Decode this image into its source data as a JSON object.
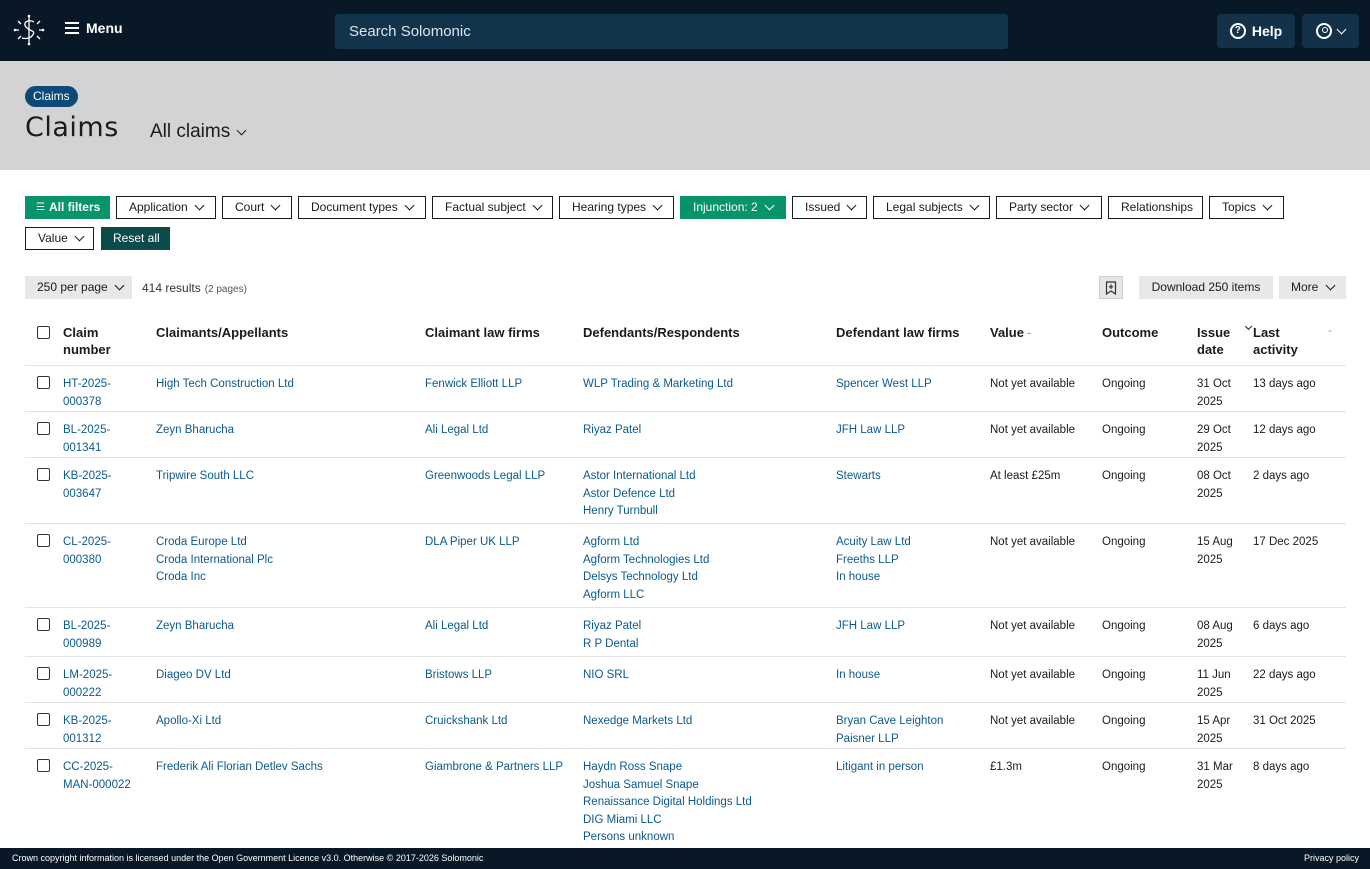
{
  "nav": {
    "menu_label": "Menu",
    "search_placeholder": "Search Solomonic",
    "help_label": "Help"
  },
  "header": {
    "breadcrumb": "Claims",
    "title": "Claims",
    "view": "All claims"
  },
  "filters": {
    "all_filters": "All filters",
    "items": [
      "Application",
      "Court",
      "Document types",
      "Factual subject",
      "Hearing types",
      "Injunction: 2",
      "Issued",
      "Legal subjects",
      "Party sector",
      "Relationships",
      "Topics",
      "Value"
    ],
    "reset": "Reset all"
  },
  "results": {
    "per_page": "250 per page",
    "count": "414 results",
    "pages": "(2 pages)",
    "download": "Download 250 items",
    "more": "More"
  },
  "table": {
    "columns": [
      "Claim number",
      "Claimants/Appellants",
      "Claimant law firms",
      "Defendants/Respondents",
      "Defendant law firms",
      "Value",
      "Outcome",
      "Issue date",
      "Last activity"
    ],
    "rows": [
      {
        "claim": [
          "HT-2025-",
          "000378"
        ],
        "claimants": [
          "High Tech Construction Ltd"
        ],
        "claimant_firms": [
          "Fenwick Elliott LLP"
        ],
        "defendants": [
          "WLP Trading & Marketing Ltd"
        ],
        "defendant_firms": [
          "Spencer West LLP"
        ],
        "value": "Not yet available",
        "outcome": "Ongoing",
        "issue_date": [
          "31 Oct",
          "2025"
        ],
        "last_activity": "13 days ago"
      },
      {
        "claim": [
          "BL-2025-",
          "001341"
        ],
        "claimants": [
          "Zeyn Bharucha"
        ],
        "claimant_firms": [
          "Ali Legal Ltd"
        ],
        "defendants": [
          "Riyaz Patel"
        ],
        "defendant_firms": [
          "JFH Law LLP"
        ],
        "value": "Not yet available",
        "outcome": "Ongoing",
        "issue_date": [
          "29 Oct",
          "2025"
        ],
        "last_activity": "12 days ago"
      },
      {
        "claim": [
          "KB-2025-",
          "003647"
        ],
        "claimants": [
          "Tripwire South LLC"
        ],
        "claimant_firms": [
          "Greenwoods Legal LLP"
        ],
        "defendants": [
          "Astor International Ltd",
          "Astor Defence Ltd",
          "Henry Turnbull"
        ],
        "defendant_firms": [
          "Stewarts"
        ],
        "value": "At least £25m",
        "outcome": "Ongoing",
        "issue_date": [
          "08 Oct",
          "2025"
        ],
        "last_activity": "2 days ago"
      },
      {
        "claim": [
          "CL-2025-",
          "000380"
        ],
        "claimants": [
          "Croda Europe Ltd",
          "Croda International Plc",
          "Croda Inc"
        ],
        "claimant_firms": [
          "DLA Piper UK LLP"
        ],
        "defendants": [
          "Agform Ltd",
          "Agform Technologies Ltd",
          "Delsys Technology Ltd",
          "Agform LLC"
        ],
        "defendant_firms": [
          "Acuity Law Ltd",
          "Freeths LLP",
          "In house"
        ],
        "value": "Not yet available",
        "outcome": "Ongoing",
        "issue_date": [
          "15 Aug",
          "2025"
        ],
        "last_activity": "17 Dec 2025"
      },
      {
        "claim": [
          "BL-2025-",
          "000989"
        ],
        "claimants": [
          "Zeyn Bharucha"
        ],
        "claimant_firms": [
          "Ali Legal Ltd"
        ],
        "defendants": [
          "Riyaz Patel",
          "R P Dental"
        ],
        "defendant_firms": [
          "JFH Law LLP"
        ],
        "value": "Not yet available",
        "outcome": "Ongoing",
        "issue_date": [
          "08 Aug",
          "2025"
        ],
        "last_activity": "6 days ago"
      },
      {
        "claim": [
          "LM-2025-",
          "000222"
        ],
        "claimants": [
          "Diageo DV Ltd"
        ],
        "claimant_firms": [
          "Bristows LLP"
        ],
        "defendants": [
          "NIO SRL"
        ],
        "defendant_firms": [
          "In house"
        ],
        "value": "Not yet available",
        "outcome": "Ongoing",
        "issue_date": [
          "11 Jun",
          "2025"
        ],
        "last_activity": "22 days ago"
      },
      {
        "claim": [
          "KB-2025-",
          "001312"
        ],
        "claimants": [
          "Apollo-Xi Ltd"
        ],
        "claimant_firms": [
          "Cruickshank Ltd"
        ],
        "defendants": [
          "Nexedge Markets Ltd"
        ],
        "defendant_firms": [
          "Bryan Cave Leighton",
          "Paisner LLP"
        ],
        "value": "Not yet available",
        "outcome": "Ongoing",
        "issue_date": [
          "15 Apr",
          "2025"
        ],
        "last_activity": "31 Oct 2025"
      },
      {
        "claim": [
          "CC-2025-",
          "MAN-000022"
        ],
        "claimants": [
          "Frederik Ali Florian Detlev Sachs"
        ],
        "claimant_firms": [
          "Giambrone & Partners LLP"
        ],
        "defendants": [
          "Haydn Ross Snape",
          "Joshua Samuel Snape",
          "Renaissance Digital Holdings Ltd",
          "DIG Miami LLC",
          "Persons unknown"
        ],
        "defendant_firms": [
          "Litigant in person"
        ],
        "value": "£1.3m",
        "outcome": "Ongoing",
        "issue_date": [
          "31 Mar",
          "2025"
        ],
        "last_activity": "8 days ago"
      }
    ]
  },
  "footer": {
    "copyright": "Crown copyright information is licensed under the Open Government Licence v3.0. Otherwise © 2017-2026 Solomonic",
    "privacy": "Privacy policy"
  },
  "colors": {
    "nav_bg": "#091826",
    "link": "#0b5a8c",
    "accent_green": "#07936b",
    "reset_bg": "#0d4a4a",
    "band_bg": "#d3d3d3"
  }
}
